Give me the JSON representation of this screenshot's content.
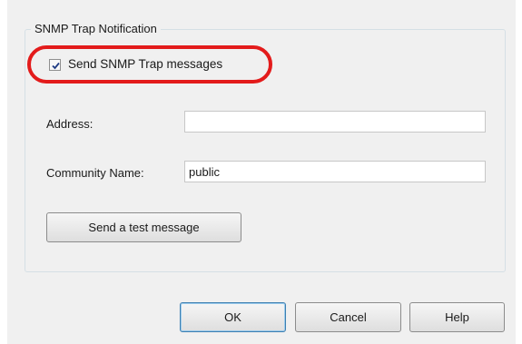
{
  "group": {
    "title": "SNMP Trap Notification"
  },
  "send_trap": {
    "label": "Send SNMP Trap messages",
    "checked": true
  },
  "address": {
    "label": "Address:",
    "value": ""
  },
  "community": {
    "label": "Community Name:",
    "value": "public"
  },
  "buttons": {
    "test": "Send a test message",
    "ok": "OK",
    "cancel": "Cancel",
    "help": "Help"
  },
  "colors": {
    "highlight": "#e31b1b",
    "dialog_background": "#f0f0f0",
    "checkmark": "#1f3b84"
  },
  "icons": {
    "checkbox": "checkmark-icon"
  }
}
